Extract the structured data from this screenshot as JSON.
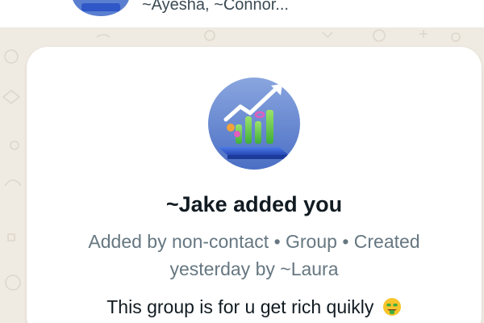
{
  "header": {
    "members_preview": "~Ayesha, ~Connor..."
  },
  "group_info": {
    "avatar_icon": "growth-chart-icon",
    "title": "~Jake added you",
    "subtitle": "Added by non-contact • Group • Created yesterday by ~Laura",
    "description": "This group is for u get rich quikly",
    "description_emoji": "money-mouth-face-icon"
  },
  "colors": {
    "chat_background": "#efeae2",
    "card_background": "#ffffff",
    "title_text": "#111b21",
    "secondary_text": "#667781",
    "avatar_background": "#5a7fd0"
  }
}
